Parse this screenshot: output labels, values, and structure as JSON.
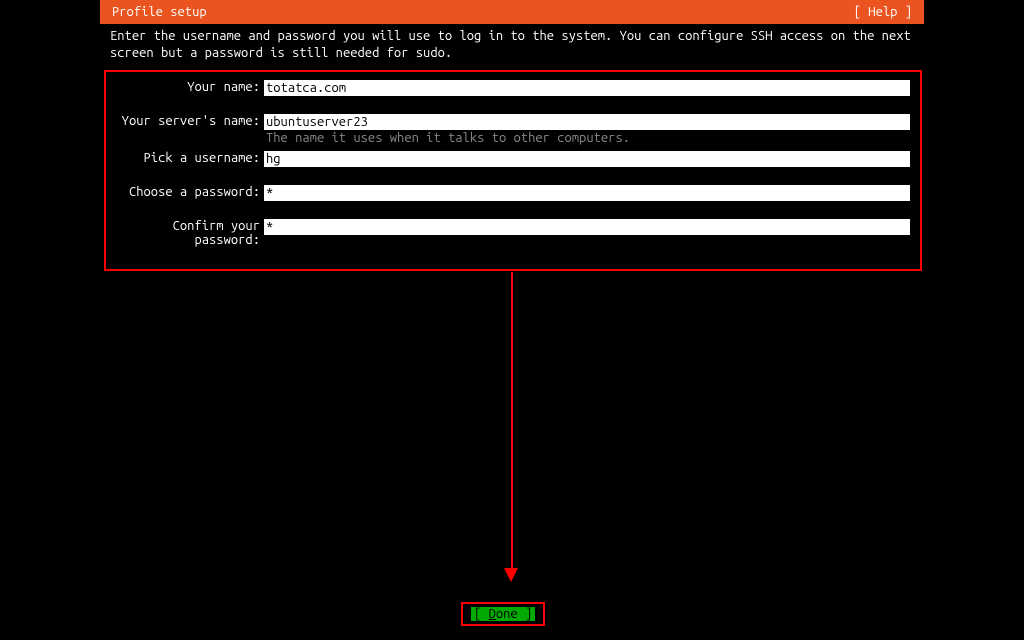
{
  "header": {
    "title": "Profile setup",
    "help": "[ Help ]"
  },
  "instructions": "Enter the username and password you will use to log in to the system. You can configure SSH access on the next screen but a password is still needed for sudo.",
  "form": {
    "your_name": {
      "label": "Your name:",
      "value": "totatca.com"
    },
    "server_name": {
      "label": "Your server's name:",
      "value": "ubuntuserver23",
      "hint": "The name it uses when it talks to other computers."
    },
    "username": {
      "label": "Pick a username:",
      "value": "hg"
    },
    "password": {
      "label": "Choose a password:",
      "value": "*"
    },
    "confirm": {
      "label": "Confirm your password:",
      "value": "*"
    }
  },
  "done": {
    "prefix": "[ ",
    "letter": "D",
    "rest": "one",
    "suffix": "    ]"
  }
}
